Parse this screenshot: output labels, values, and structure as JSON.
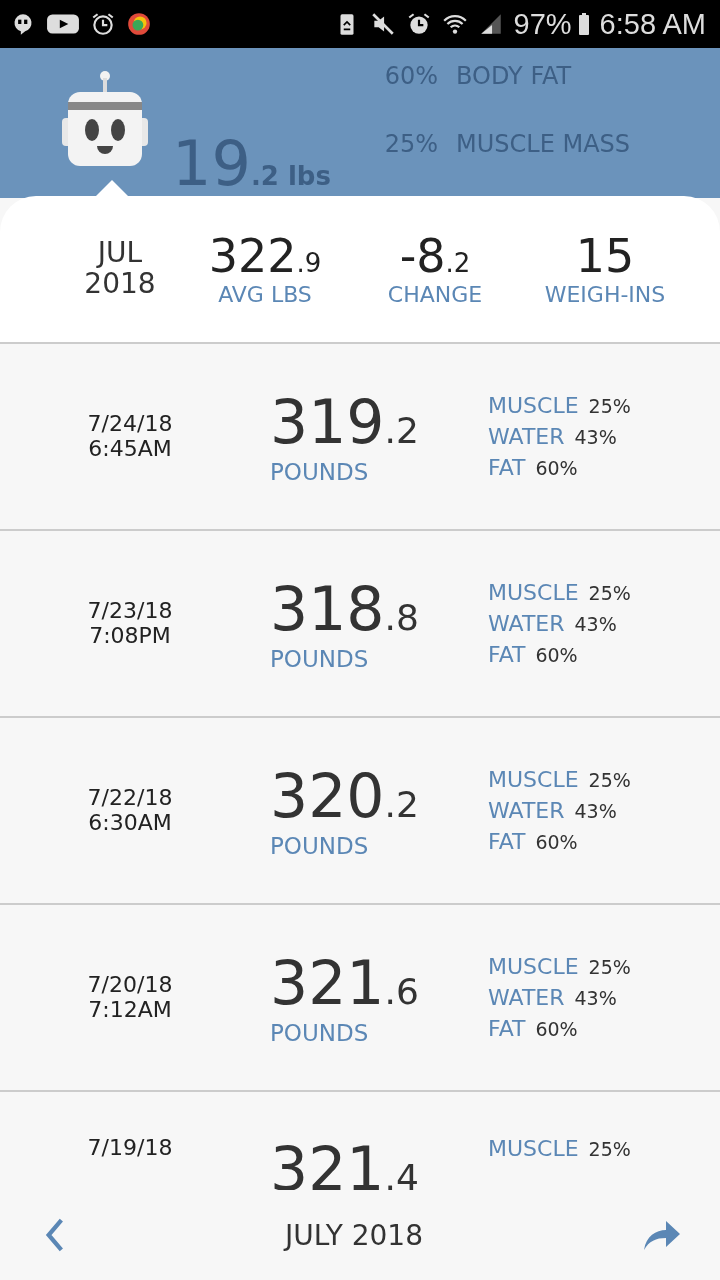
{
  "status_bar": {
    "battery": "97%",
    "time": "6:58 AM"
  },
  "header": {
    "stats": [
      {
        "value": "60%",
        "label": "BODY FAT"
      },
      {
        "value": "25%",
        "label": "MUSCLE MASS"
      }
    ],
    "weight": "19",
    "weight_unit": ".2 lbs"
  },
  "summary": [
    {
      "kind": "month",
      "line1": "JUL",
      "line2": "2018"
    },
    {
      "kind": "stat",
      "whole": "322",
      "decimal": ".9",
      "label": "AVG LBS"
    },
    {
      "kind": "stat",
      "whole": "-8",
      "decimal": ".2",
      "label": "CHANGE"
    },
    {
      "kind": "stat",
      "whole": "15",
      "label": "WEIGH-INS"
    }
  ],
  "entries": [
    {
      "date": "7/24/18",
      "time": "6:45AM",
      "whole": "319",
      "decimal": ".2",
      "unit": "POUNDS",
      "metrics": [
        {
          "label": "MUSCLE",
          "value": "25%"
        },
        {
          "label": "WATER",
          "value": "43%"
        },
        {
          "label": "FAT",
          "value": "60%"
        }
      ]
    },
    {
      "date": "7/23/18",
      "time": "7:08PM",
      "whole": "318",
      "decimal": ".8",
      "unit": "POUNDS",
      "metrics": [
        {
          "label": "MUSCLE",
          "value": "25%"
        },
        {
          "label": "WATER",
          "value": "43%"
        },
        {
          "label": "FAT",
          "value": "60%"
        }
      ]
    },
    {
      "date": "7/22/18",
      "time": "6:30AM",
      "whole": "320",
      "decimal": ".2",
      "unit": "POUNDS",
      "metrics": [
        {
          "label": "MUSCLE",
          "value": "25%"
        },
        {
          "label": "WATER",
          "value": "43%"
        },
        {
          "label": "FAT",
          "value": "60%"
        }
      ]
    },
    {
      "date": "7/20/18",
      "time": "7:12AM",
      "whole": "321",
      "decimal": ".6",
      "unit": "POUNDS",
      "metrics": [
        {
          "label": "MUSCLE",
          "value": "25%"
        },
        {
          "label": "WATER",
          "value": "43%"
        },
        {
          "label": "FAT",
          "value": "60%"
        }
      ]
    },
    {
      "date": "7/19/18",
      "whole": "321",
      "decimal": ".4",
      "metrics": [
        {
          "label": "MUSCLE",
          "value": "25%"
        }
      ]
    }
  ],
  "footer": {
    "title": "JULY 2018"
  }
}
